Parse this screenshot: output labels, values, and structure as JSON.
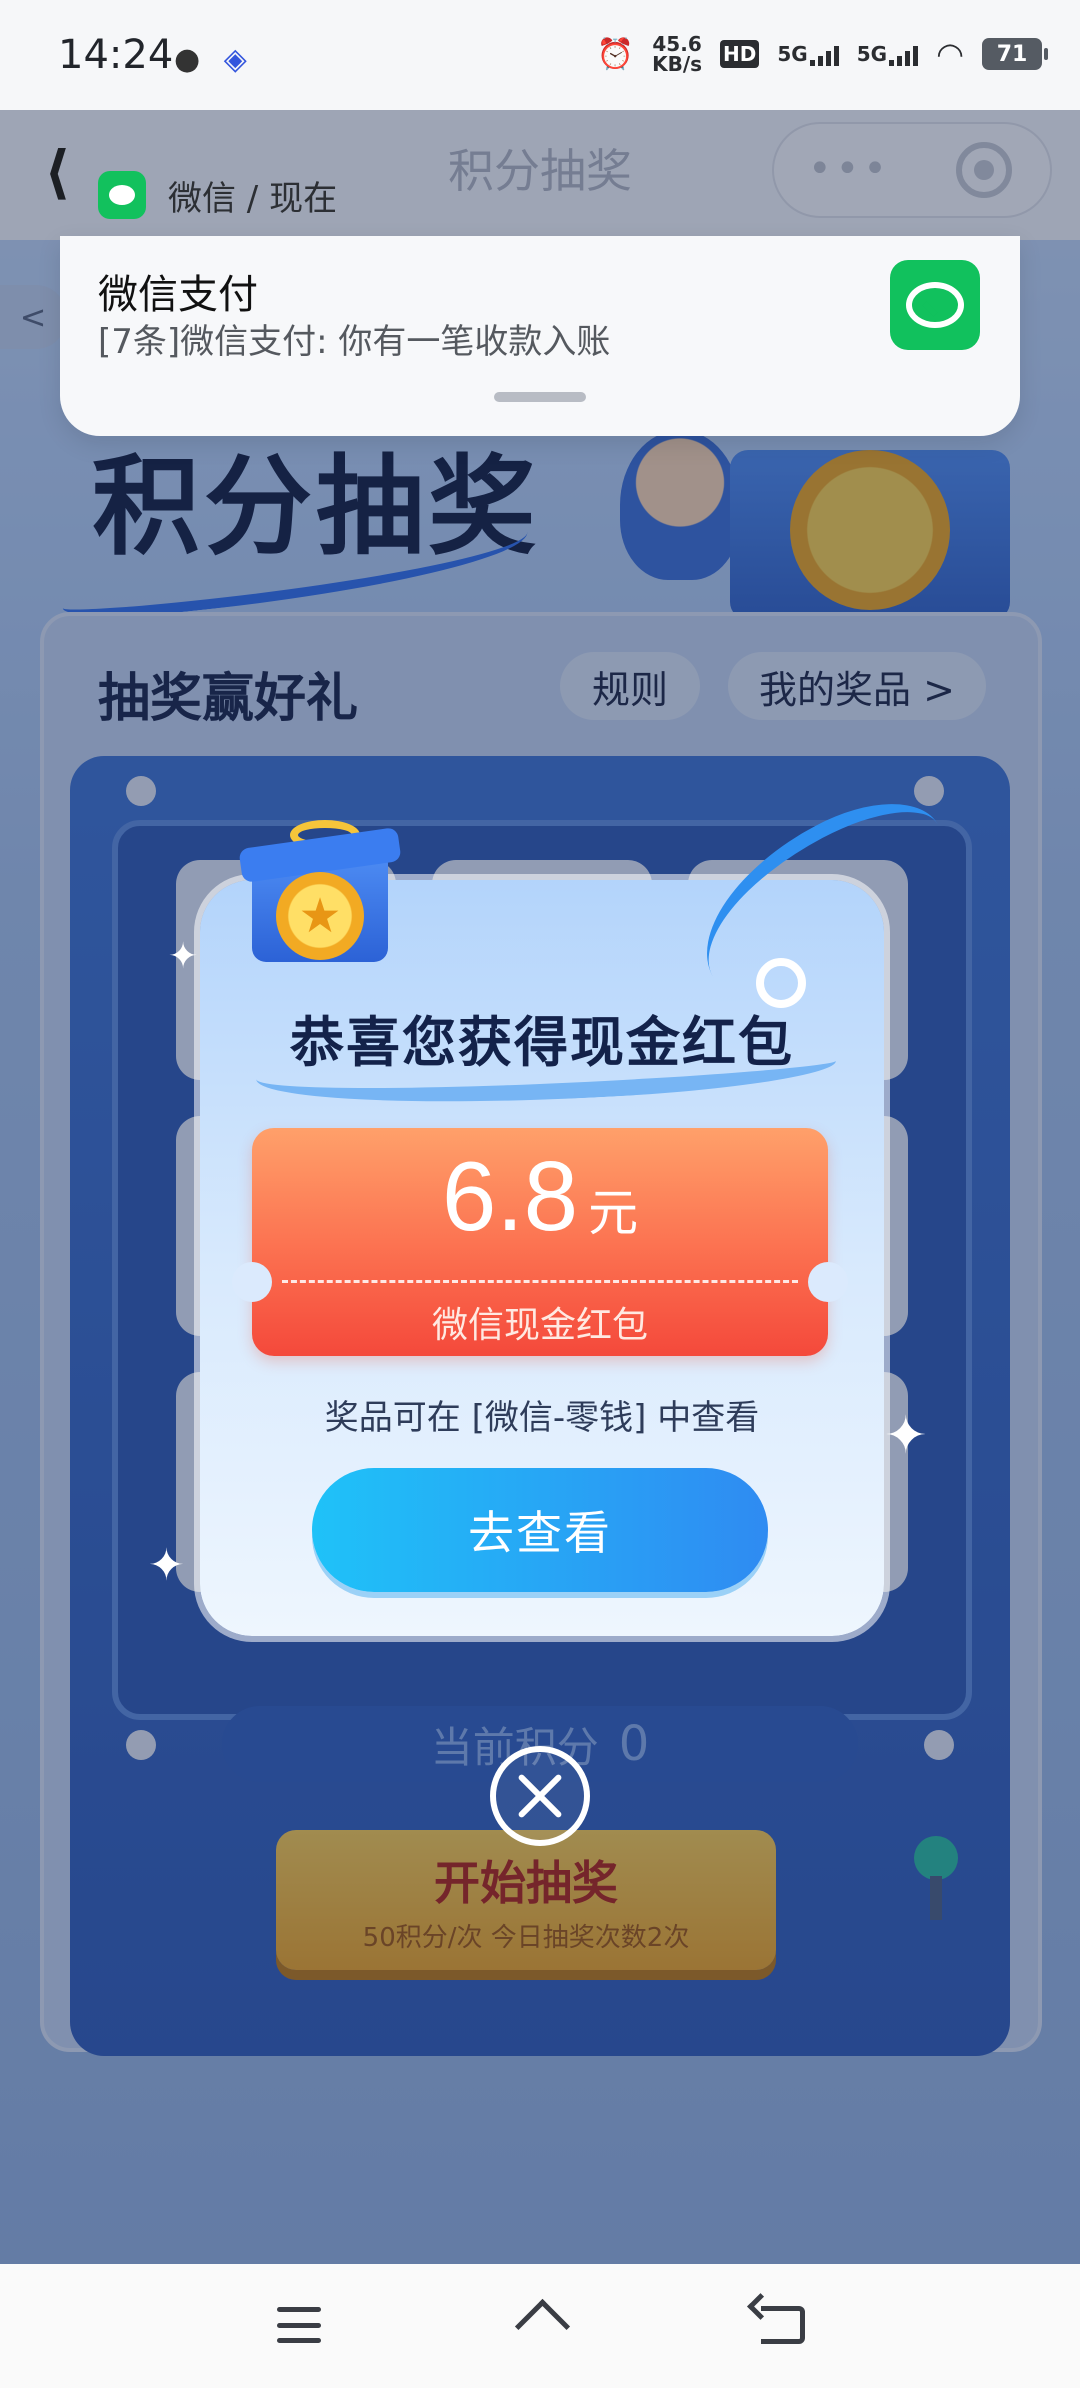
{
  "status_bar": {
    "time": "14:24",
    "net_speed_value": "45.6",
    "net_speed_unit": "KB/s",
    "hd_label": "HD",
    "sim1_network": "5G",
    "sim2_network": "5G",
    "battery": "71"
  },
  "notification": {
    "app_label": "微信 / 现在",
    "title": "微信支付",
    "body": "[7条]微信支付: 你有一笔收款入账",
    "icon": "wechat-pay-icon"
  },
  "page": {
    "header_title": "积分抽奖",
    "hero_title": "积分抽奖",
    "section_title": "抽奖赢好礼",
    "rules_button": "规则",
    "my_prizes_button": "我的奖品 >",
    "score_label": "当前积分",
    "score_value": "0",
    "start_button": "开始抽奖",
    "start_sub": "50积分/次 今日抽奖次数2次"
  },
  "modal": {
    "title": "恭喜您获得现金红包",
    "amount": "6.8",
    "unit": "元",
    "prize_label": "微信现金红包",
    "hint": "奖品可在 [微信-零钱] 中查看",
    "view_button": "去查看"
  },
  "colors": {
    "accent_blue": "#2f8bf2",
    "ticket_orange": "#fb6b4d",
    "wechat_green": "#12c15d"
  }
}
